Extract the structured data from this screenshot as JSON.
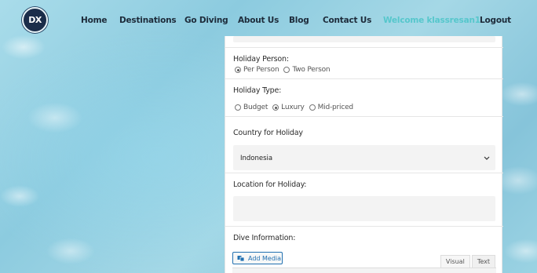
{
  "brand": {
    "logo_text": "DX"
  },
  "nav": {
    "home": "Home",
    "destinations": "Destinations",
    "go_diving": "Go Diving",
    "about": "About Us",
    "blog": "Blog",
    "contact": "Contact Us",
    "welcome": "Welcome klassresan1",
    "logout": "Logout"
  },
  "colors": {
    "accent": "#56c7cc",
    "nav_text": "#1d2b3a",
    "link_blue": "#2271b1"
  },
  "form": {
    "holiday_person": {
      "label": "Holiday Person:",
      "options": [
        "Per Person",
        "Two Person"
      ],
      "selected": "Per Person"
    },
    "holiday_type": {
      "label": "Holiday Type:",
      "options": [
        "Budget",
        "Luxury",
        "Mid-priced"
      ],
      "selected": "Luxury"
    },
    "country": {
      "label": "Country for Holiday",
      "value": "Indonesia"
    },
    "location": {
      "label": "Location for Holiday:",
      "value": ""
    },
    "dive_info": {
      "label": "Dive Information:",
      "add_media": "Add Media",
      "tab_visual": "Visual",
      "tab_text": "Text"
    }
  }
}
